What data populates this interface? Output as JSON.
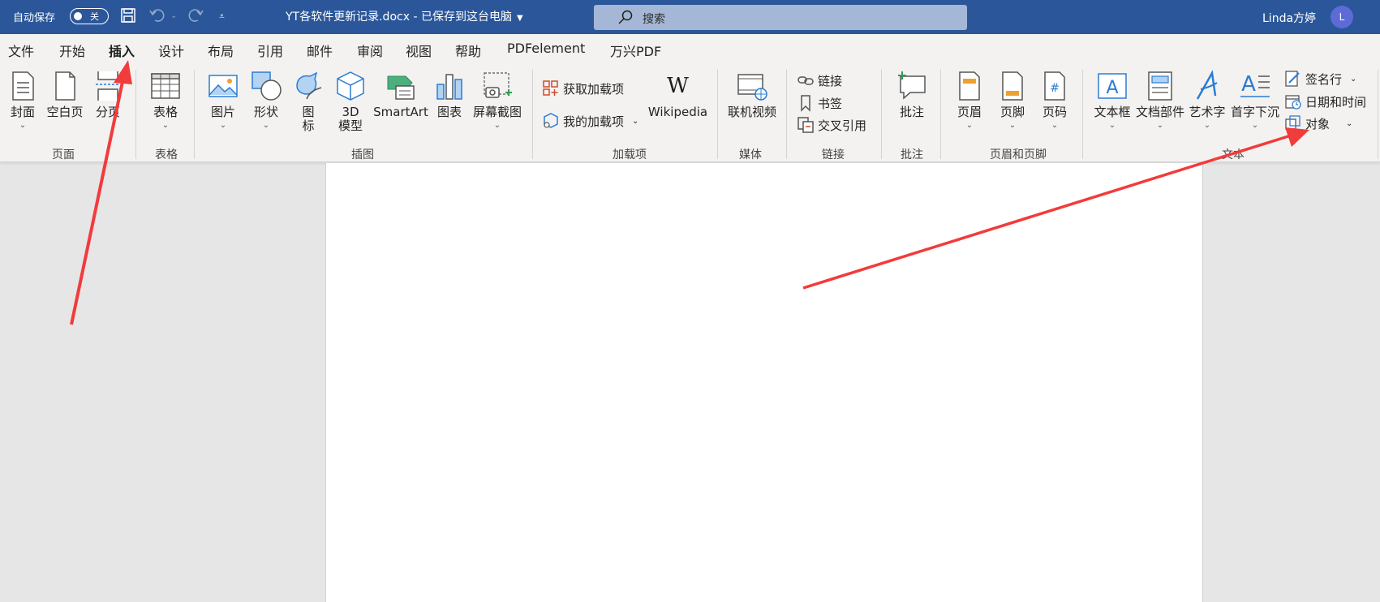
{
  "titlebar": {
    "autosave_label": "自动保存",
    "autosave_state": "关",
    "doc_title": "YT各软件更新记录.docx  -  已保存到这台电脑",
    "search_placeholder": "搜索",
    "user_name": "Linda方婷",
    "avatar_initial": "L"
  },
  "menu": {
    "tabs": [
      "文件",
      "开始",
      "插入",
      "设计",
      "布局",
      "引用",
      "邮件",
      "审阅",
      "视图",
      "帮助",
      "PDFelement",
      "万兴PDF"
    ],
    "active": "插入"
  },
  "ribbon": {
    "pages": {
      "cover": "封面",
      "blank": "空白页",
      "break": "分页",
      "group": "页面"
    },
    "tables": {
      "table": "表格",
      "group": "表格"
    },
    "illustrations": {
      "picture": "图片",
      "shapes": "形状",
      "icons_1": "图",
      "icons_2": "标",
      "model_1": "3D",
      "model_2": "模型",
      "smartart": "SmartArt",
      "chart": "图表",
      "screenshot": "屏幕截图",
      "group": "插图"
    },
    "addins": {
      "get": "获取加载项",
      "mine": "我的加载项",
      "wikipedia": "Wikipedia",
      "wiki_glyph": "W",
      "group": "加载项"
    },
    "media": {
      "video": "联机视频",
      "group": "媒体"
    },
    "links": {
      "link": "链接",
      "bookmark": "书签",
      "crossref": "交叉引用",
      "group": "链接"
    },
    "comments": {
      "comment": "批注",
      "group": "批注"
    },
    "header_footer": {
      "header": "页眉",
      "footer": "页脚",
      "page_number": "页码",
      "group": "页眉和页脚"
    },
    "text": {
      "textbox": "文本框",
      "quickparts": "文档部件",
      "wordart": "艺术字",
      "dropcap": "首字下沉",
      "signature": "签名行",
      "datetime": "日期和时间",
      "object": "对象",
      "group": "文本"
    }
  },
  "colors": {
    "titlebar": "#2b579a",
    "ribbon": "#f3f2f1",
    "annotation_arrow": "#f23b3b",
    "icon_blue": "#2b7cd3"
  }
}
